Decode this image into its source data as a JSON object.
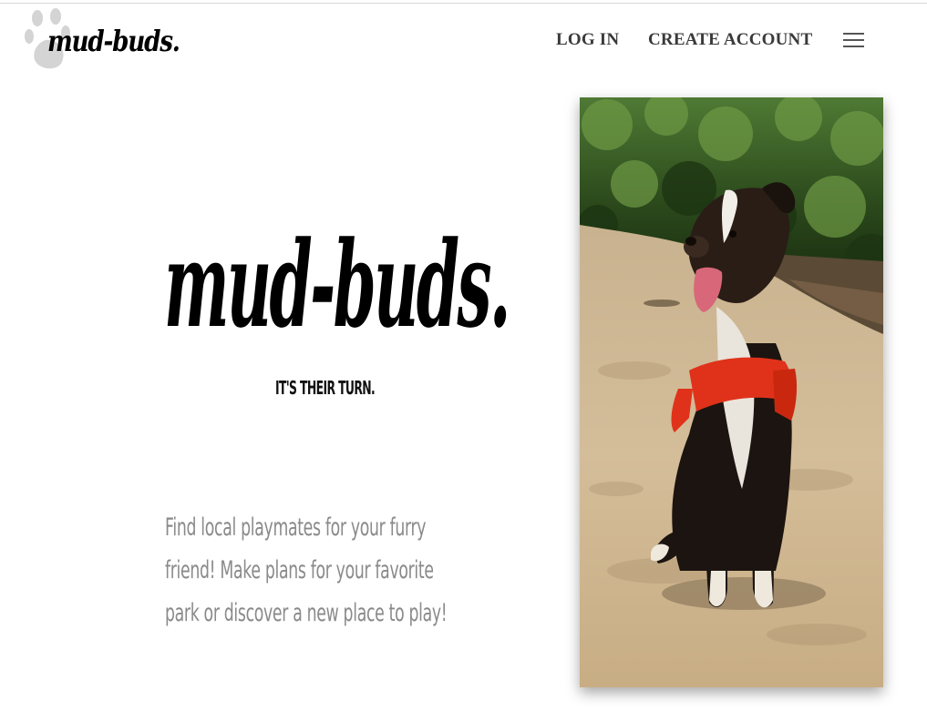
{
  "header": {
    "logo_text": "mud-buds.",
    "nav": {
      "login_label": "LOG IN",
      "create_account_label": "CREATE ACCOUNT"
    },
    "menu_icon": "hamburger-menu-icon"
  },
  "hero": {
    "title": "mud-buds.",
    "tagline": "IT'S THEIR TURN.",
    "description_lines": [
      "Find local playmates for your furry",
      "friend! Make plans for your favorite",
      "park or discover a new place to play!"
    ]
  },
  "photo": {
    "subject": "dog-sitting-on-riverbank-photo"
  },
  "colors": {
    "nav_text": "#3a3a3a",
    "description_text": "#8a8a8a",
    "harness": "#e0321a",
    "paw": "#d4d4d4"
  }
}
